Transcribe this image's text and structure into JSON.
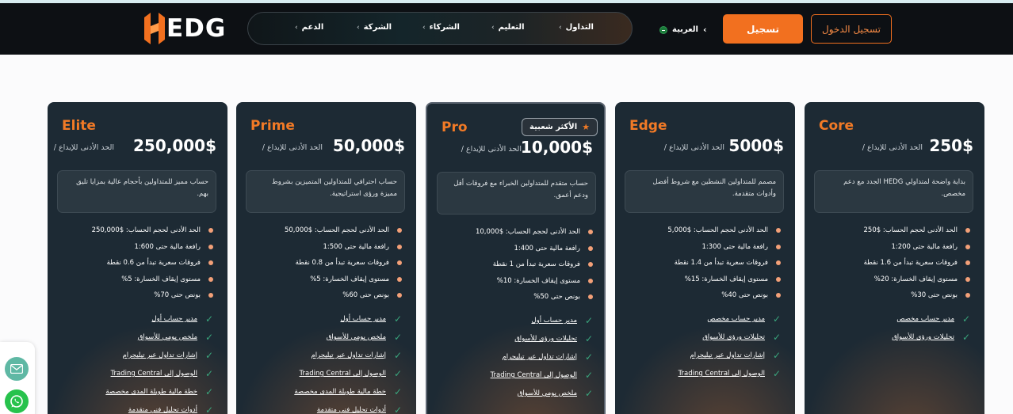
{
  "header": {
    "logo_text": "EDG",
    "nav": [
      {
        "label": "التداول"
      },
      {
        "label": "التعليم"
      },
      {
        "label": "الشركاء"
      },
      {
        "label": "الشركة"
      },
      {
        "label": "الدعم"
      }
    ],
    "language": "العربية",
    "register_label": "تسجيل",
    "login_label": "تسجيل الدخول"
  },
  "colors": {
    "accent": "#f2701f",
    "card_bg": "#1d2a34",
    "check": "#3aa67d",
    "dot": "#f3a078"
  },
  "deposit_label": "/ الحد الأدنى للإيداع",
  "cards": [
    {
      "name": "Core",
      "price": "250$",
      "desc": "بداية واضحة لمتداولي HEDG الجدد مع دعم مخصص.",
      "specs": [
        "الحد الأدنى لحجم الحساب: $250",
        "رافعة مالية حتى 1:200",
        "فروقات سعرية تبدأ من 1.6 نقطة",
        "مستوى إيقاف الخسارة: 20%",
        "بونص حتى 30%"
      ],
      "perks": [
        "مدير حساب مخصص",
        "تحليلات ورؤى للأسواق"
      ]
    },
    {
      "name": "Edge",
      "price": "5000$",
      "desc": "مصمم للمتداولين النشطين مع شروط أفضل وأدوات متقدمة.",
      "specs": [
        "الحد الأدنى لحجم الحساب: $5,000",
        "رافعة مالية حتى 1:300",
        "فروقات سعرية تبدأ من 1.4 نقطة",
        "مستوى إيقاف الخسارة: 15%",
        "بونص حتى 40%"
      ],
      "perks": [
        "مدير حساب مخصص",
        "تحليلات ورؤى للأسواق",
        "إشارات تداول عبر تيليجرام",
        "الوصول إلى Trading Central"
      ]
    },
    {
      "name": "Pro",
      "price": "10,000$",
      "badge": "الأكثر شعبية",
      "desc": "حساب متقدم للمتداولين الخبراء مع فروقات أقل ودعم أعمق.",
      "specs": [
        "الحد الأدنى لحجم الحساب: $10,000",
        "رافعة مالية حتى 1:400",
        "فروقات سعرية تبدأ من 1 نقطة",
        "مستوى إيقاف الخسارة: 10%",
        "بونص حتى 50%"
      ],
      "perks": [
        "مدير حساب أول",
        "تحليلات ورؤى للأسواق",
        "إشارات تداول عبر تيليجرام",
        "الوصول إلى Trading Central",
        "ملخص يومي للأسواق"
      ]
    },
    {
      "name": "Prime",
      "price": "50,000$",
      "desc": "حساب احترافي للمتداولين المتميزين بشروط مميزة ورؤى استراتيجية.",
      "specs": [
        "الحد الأدنى لحجم الحساب: $50,000",
        "رافعة مالية حتى 1:500",
        "فروقات سعرية تبدأ من 0.8 نقطة",
        "مستوى إيقاف الخسارة: 5%",
        "بونص حتى 60%"
      ],
      "perks": [
        "مدير حساب أول",
        "ملخص يومي للأسواق",
        "إشارات تداول عبر تيليجرام",
        "الوصول إلى Trading Central",
        "خطة مالية طويلة المدى مخصصة",
        "أدوات تحليل فني متقدمة"
      ]
    },
    {
      "name": "Elite",
      "price": "250,000$",
      "desc": "حساب مميز للمتداولين بأحجام عالية بمزايا تليق بهم.",
      "specs": [
        "الحد الأدنى لحجم الحساب: $250,000",
        "رافعة مالية حتى 1:600",
        "فروقات سعرية تبدأ من 0.6 نقطة",
        "مستوى إيقاف الخسارة: 5%",
        "بونص حتى 70%"
      ],
      "perks": [
        "مدير حساب أول",
        "ملخص يومي للأسواق",
        "إشارات تداول عبر تيليجرام",
        "الوصول إلى Trading Central",
        "خطة مالية طويلة المدى مخصصة",
        "أدوات تحليل فني متقدمة"
      ]
    }
  ]
}
